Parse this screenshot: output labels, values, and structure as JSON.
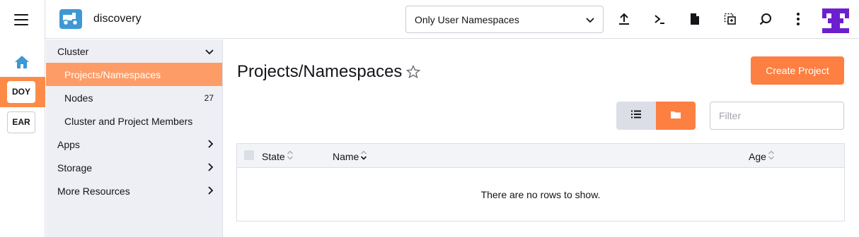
{
  "rail": {
    "clusters": [
      {
        "label": "DOY",
        "active": true
      },
      {
        "label": "EAR",
        "active": false
      }
    ]
  },
  "header": {
    "cluster_name": "discovery",
    "namespace_filter": "Only User Namespaces",
    "icons": [
      "import-yaml-icon",
      "kubectl-shell-icon",
      "kubeconfig-download-icon",
      "copy-kubeconfig-icon",
      "resource-search-icon",
      "more-actions-icon"
    ]
  },
  "sidenav": {
    "cluster_label": "Cluster",
    "items": [
      {
        "label": "Projects/Namespaces",
        "count": ""
      },
      {
        "label": "Nodes",
        "count": "27"
      },
      {
        "label": "Cluster and Project Members",
        "count": ""
      }
    ],
    "groups": [
      {
        "label": "Apps"
      },
      {
        "label": "Storage"
      },
      {
        "label": "More Resources"
      }
    ]
  },
  "main": {
    "title": "Projects/Namespaces",
    "create_label": "Create Project",
    "filter_placeholder": "Filter",
    "columns": [
      "State",
      "Name",
      "Age"
    ],
    "empty_message": "There are no rows to show."
  },
  "colors": {
    "accent": "#fd7f42",
    "active_nav": "#fd9c66",
    "logo_blue": "#3d98d3",
    "avatar_purple": "#6d1fcf"
  }
}
